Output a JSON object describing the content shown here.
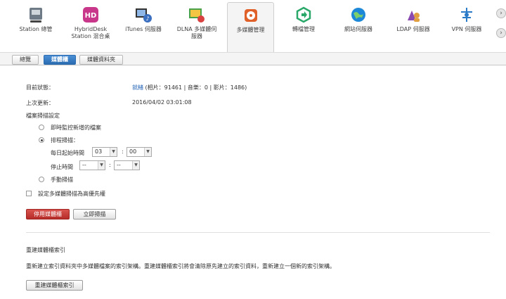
{
  "apps": [
    {
      "label": "Station 總管",
      "icon": "station-manager-icon",
      "color": "#6e7a86"
    },
    {
      "label": "HybridDesk\nStation 混合桌",
      "icon": "hybriddesk-icon",
      "color": "#c8378a"
    },
    {
      "label": "iTunes 伺服器",
      "icon": "itunes-server-icon",
      "color": "#3b6fc0"
    },
    {
      "label": "DLNA 多媒體伺\n服器",
      "icon": "dlna-server-icon",
      "color": "#4aa34a"
    },
    {
      "label": "多媒體管理",
      "icon": "multimedia-management-icon",
      "color": "#e0602a"
    },
    {
      "label": "轉檔管理",
      "icon": "transcode-management-icon",
      "color": "#2aa86a"
    },
    {
      "label": "網站伺服器",
      "icon": "web-server-icon",
      "color": "#1e88d8"
    },
    {
      "label": "LDAP 伺服器",
      "icon": "ldap-server-icon",
      "color": "#8a4ab0"
    },
    {
      "label": "VPN 伺服器",
      "icon": "vpn-server-icon",
      "color": "#2a7ac8"
    }
  ],
  "tabs": [
    "總覽",
    "媒體櫃",
    "媒體資料夾"
  ],
  "status": {
    "current_label": "目前狀態：",
    "current_link": "就緒",
    "current_detail": " (相片：91461 | 音樂：0 | 影片：1486)",
    "last_update_label": "上次更新：",
    "last_update_value": "2016/04/02 03:01:08"
  },
  "scan": {
    "section_label": "檔案掃描設定",
    "option_realtime": "即時監控新增的檔案",
    "option_scheduled": "排程掃描：",
    "daily_start_label": "每日起始時間",
    "start_hour": "03",
    "start_min": "00",
    "stop_label": "停止時間",
    "stop_hour": "--",
    "stop_min": "--",
    "colon": ":",
    "option_manual": "手動掃描",
    "priority_label": "設定多媒體掃描為高優先權"
  },
  "buttons": {
    "disable_library": "停用媒體櫃",
    "scan_now": "立即掃描",
    "rebuild_index": "重建媒體櫃索引"
  },
  "rebuild": {
    "title": "重建媒體櫃索引",
    "description": "重新建立索引資料夾中多媒體檔案的索引架構。重建媒體櫃索引將會清除原先建立的索引資料，重新建立一個新的索引架構。"
  },
  "nav": {
    "next1": "›",
    "next2": "›"
  }
}
